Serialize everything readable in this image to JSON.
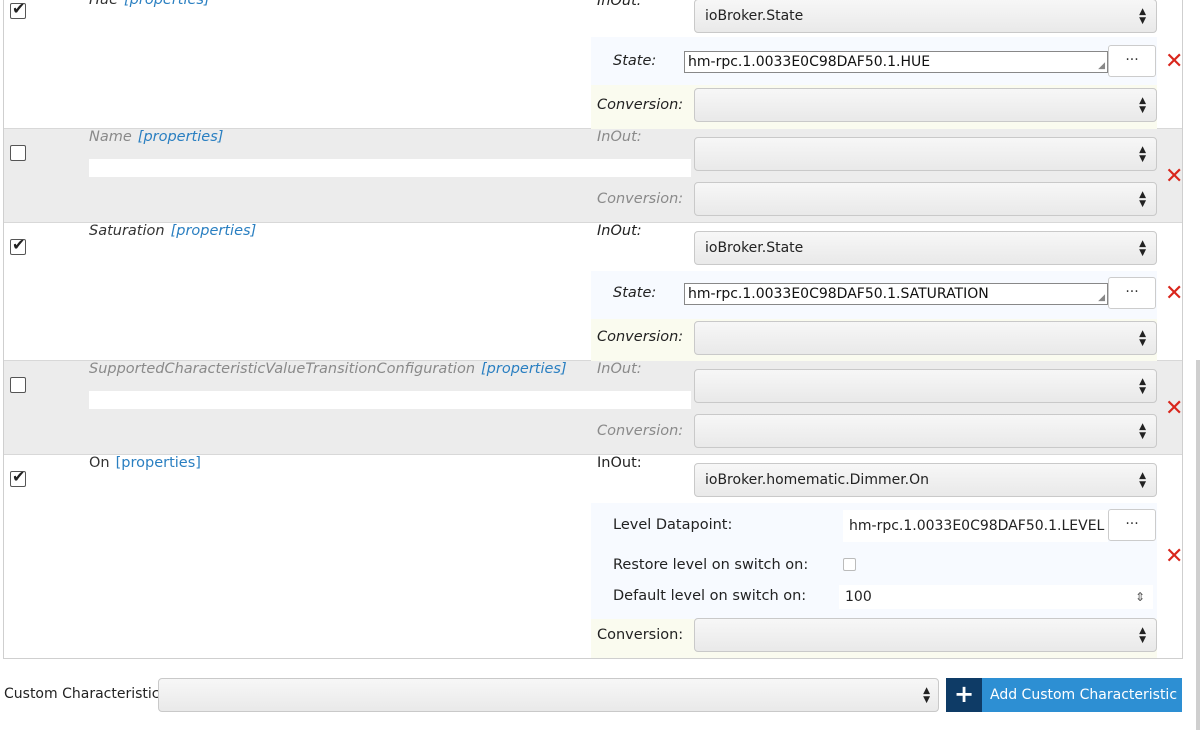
{
  "rows": {
    "hue": {
      "name": "Hue",
      "props": "[properties]",
      "inout_label": "InOut:",
      "inout_value": "ioBroker.State",
      "state_label": "State:",
      "state_value": "hm-rpc.1.0033E0C98DAF50.1.HUE",
      "conversion_label": "Conversion:",
      "conversion_value": "",
      "checked": true
    },
    "name": {
      "name": "Name",
      "props": "[properties]",
      "inout_label": "InOut:",
      "conversion_label": "Conversion:",
      "checked": false
    },
    "saturation": {
      "name": "Saturation",
      "props": "[properties]",
      "inout_label": "InOut:",
      "inout_value": "ioBroker.State",
      "state_label": "State:",
      "state_value": "hm-rpc.1.0033E0C98DAF50.1.SATURATION",
      "conversion_label": "Conversion:",
      "checked": true
    },
    "transition": {
      "name": "SupportedCharacteristicValueTransitionConfiguration",
      "props": "[properties]",
      "inout_label": "InOut:",
      "conversion_label": "Conversion:",
      "checked": false
    },
    "on": {
      "name": "On",
      "props": "[properties]",
      "inout_label": "InOut:",
      "inout_value": "ioBroker.homematic.Dimmer.On",
      "level_label": "Level Datapoint:",
      "level_value": "hm-rpc.1.0033E0C98DAF50.1.LEVEL",
      "restore_label": "Restore level on switch on:",
      "default_label": "Default level on switch on:",
      "default_value": "100",
      "conversion_label": "Conversion:",
      "checked": true
    }
  },
  "dots": "···",
  "delete_icon": "✕",
  "check_mark": "✔",
  "bottom": {
    "label": "Custom Characteristic",
    "button_label": "Add Custom Characteristic",
    "plus": "+"
  },
  "colors": {
    "accent": "#2d8fd3",
    "accent_dark": "#0e3b66",
    "delete": "#d9261c",
    "link": "#2a7fc1"
  }
}
